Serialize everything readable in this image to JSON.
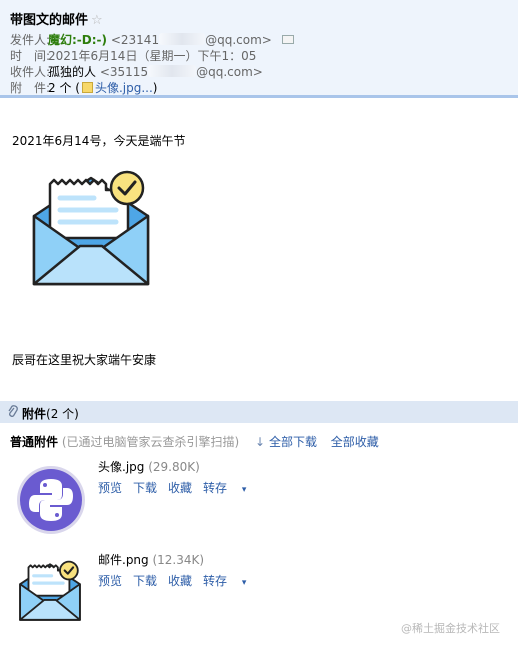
{
  "header": {
    "subject": "带图文的邮件",
    "star": "☆",
    "from_label": "发件人:",
    "from_name": "魔幻:-D:-)",
    "from_addr_start": "<23141",
    "from_addr_end": "@qq.com>",
    "time_label": "时　间:",
    "time_value": "2021年6月14日（星期一）下午1：05",
    "to_label": "收件人:",
    "to_name": "孤独的人",
    "to_addr_start": "<35115",
    "to_addr_end": "@qq.com>",
    "att_label": "附　件:",
    "att_count": "2 个 (",
    "att_file": "头像.jpg...",
    "att_close": ")"
  },
  "body": {
    "line1": "2021年6月14号，今天是端午节",
    "line2": "辰哥在这里祝大家端午安康"
  },
  "attachments": {
    "bar_title": "附件",
    "bar_count": "(2 个)",
    "kind": "普通附件",
    "scan_text": "(已通过电脑管家云查杀引擎扫描)",
    "download_all": "全部下载",
    "favorite_all": "全部收藏",
    "files": [
      {
        "name": "头像.jpg",
        "size": "(29.80K)",
        "preview": "预览",
        "download": "下载",
        "favorite": "收藏",
        "save": "转存"
      },
      {
        "name": "邮件.png",
        "size": "(12.34K)",
        "preview": "预览",
        "download": "下载",
        "favorite": "收藏",
        "save": "转存"
      }
    ]
  },
  "watermark": "@稀土掘金技术社区",
  "colors": {
    "header_bg": "#eef4fc",
    "sender_green": "#2d7d0c",
    "link_blue": "#2e5ea8",
    "attachment_bar": "#dde7f4",
    "envelope_blue": "#5fb6ef",
    "check_yellow": "#f9e27f",
    "python_purple": "#6a5bd0"
  }
}
